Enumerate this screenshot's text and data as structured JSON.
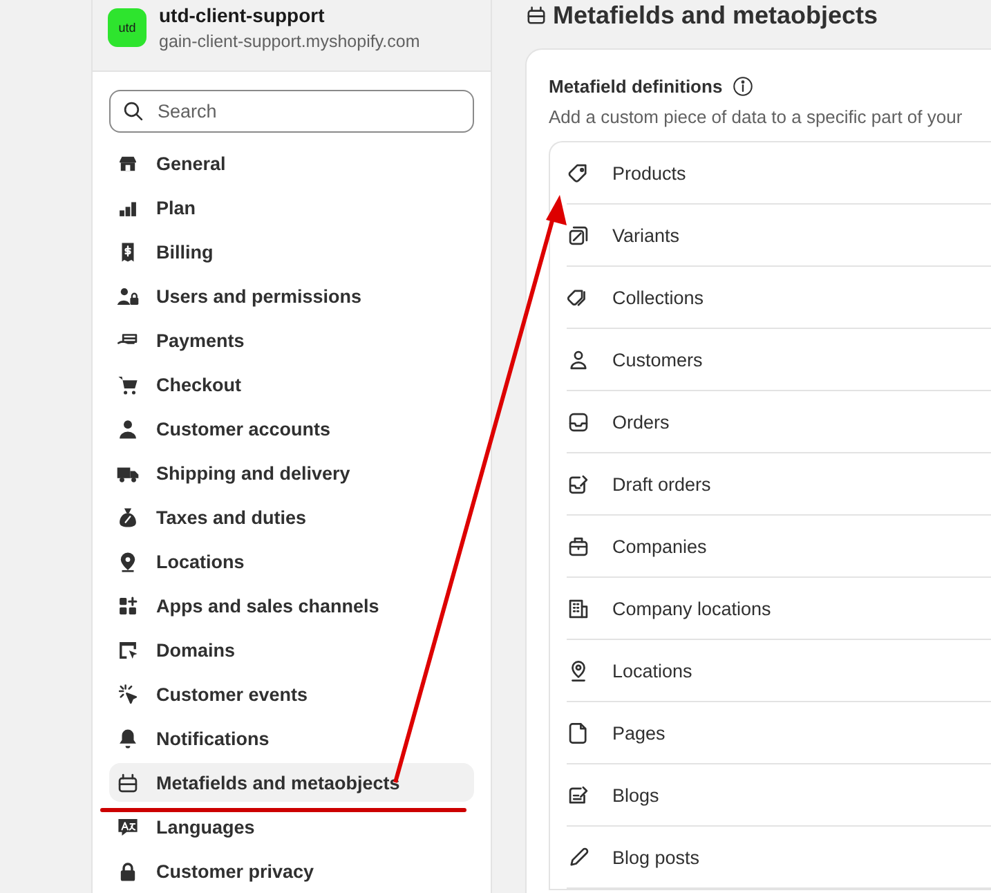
{
  "store": {
    "badge": "utd",
    "name": "utd-client-support",
    "domain": "gain-client-support.myshopify.com"
  },
  "search": {
    "placeholder": "Search"
  },
  "sidebar": {
    "items": [
      {
        "label": "General",
        "selected": false
      },
      {
        "label": "Plan",
        "selected": false
      },
      {
        "label": "Billing",
        "selected": false
      },
      {
        "label": "Users and permissions",
        "selected": false
      },
      {
        "label": "Payments",
        "selected": false
      },
      {
        "label": "Checkout",
        "selected": false
      },
      {
        "label": "Customer accounts",
        "selected": false
      },
      {
        "label": "Shipping and delivery",
        "selected": false
      },
      {
        "label": "Taxes and duties",
        "selected": false
      },
      {
        "label": "Locations",
        "selected": false
      },
      {
        "label": "Apps and sales channels",
        "selected": false
      },
      {
        "label": "Domains",
        "selected": false
      },
      {
        "label": "Customer events",
        "selected": false
      },
      {
        "label": "Notifications",
        "selected": false
      },
      {
        "label": "Metafields and metaobjects",
        "selected": true
      },
      {
        "label": "Languages",
        "selected": false
      },
      {
        "label": "Customer privacy",
        "selected": false
      }
    ]
  },
  "page": {
    "title": "Metafields and metaobjects"
  },
  "card": {
    "heading": "Metafield definitions",
    "description": "Add a custom piece of data to a specific part of your",
    "rows": [
      "Products",
      "Variants",
      "Collections",
      "Customers",
      "Orders",
      "Draft orders",
      "Companies",
      "Company locations",
      "Locations",
      "Pages",
      "Blogs",
      "Blog posts"
    ]
  }
}
